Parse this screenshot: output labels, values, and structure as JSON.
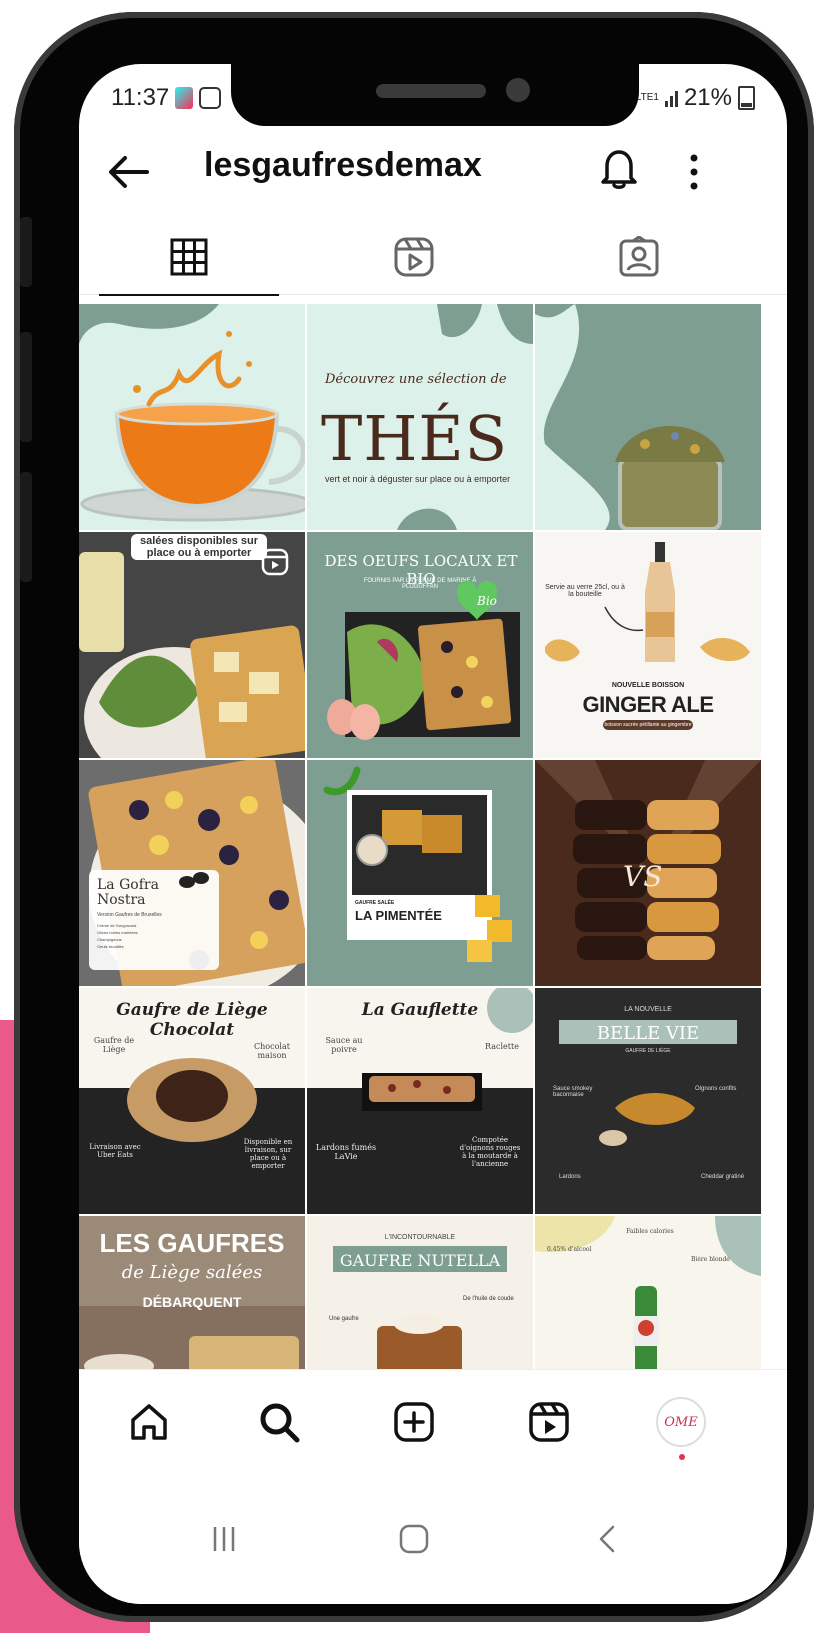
{
  "status_bar": {
    "time": "11:37",
    "network": "LTE1",
    "battery": "21%"
  },
  "header": {
    "username": "lesgaufresdemax"
  },
  "tabs": [
    {
      "name": "posts",
      "icon": "grid-icon",
      "active": true
    },
    {
      "name": "reels",
      "icon": "reels-icon",
      "active": false
    },
    {
      "name": "tagged",
      "icon": "tagged-icon",
      "active": false
    }
  ],
  "posts": {
    "p2_script": "Découvrez une sélection de",
    "p2_title": "THÉS",
    "p2_sub": "vert et noir à déguster sur place ou à emporter",
    "p4_banner": "salées disponibles sur place ou à emporter",
    "p5_title": "DES OEUFS LOCAUX ET BIO",
    "p5_sub": "FOURNIS PAR LA FERME DE MARINE À PLUGUFFAN",
    "p5_badge": "Bio",
    "p6_note": "Servie au verre 25cl, ou à la bouteille",
    "p6_small": "NOUVELLE BOISSON",
    "p6_title": "GINGER ALE",
    "p6_sub": "boisson sucrée pétillante au gingembre",
    "p7_title": "La Gofra Nostra",
    "p7_sub": "Version Gaufres de Bruxelles",
    "p7_items": [
      "Crème de Gorgonzola",
      "Olives noires marinées",
      "Champignons",
      "Oeufs brouillés"
    ],
    "p8_small": "GAUFRE SALÉE",
    "p8_title": "LA PIMENTÉE",
    "p9_vs": "VS",
    "p10_title": "Gaufre de Liège Chocolat",
    "p10_l1": "Gaufre de Liège",
    "p10_r1": "Chocolat maison",
    "p10_l2": "Livraison avec Uber Eats",
    "p10_r2": "Disponible en livraison, sur place ou à emporter",
    "p11_title": "La Gauflette",
    "p11_l1": "Sauce au poivre",
    "p11_r1": "Raclette",
    "p11_l2": "Lardons fumés LaVie",
    "p11_r2": "Compotée d'oignons rouges à la moutarde à l'ancienne",
    "p12_small": "LA NOUVELLE",
    "p12_title": "BELLE VIE",
    "p12_sub": "GAUFRE DE LIÈGE",
    "p12_l1": "Sauce smokey baconnaise",
    "p12_r1": "Oignons confits",
    "p12_l2": "Lardons",
    "p12_r2": "Cheddar gratiné",
    "p13_title": "LES GAUFRES",
    "p13_script": "de Liège salées",
    "p13_sub": "DÉBARQUENT",
    "p14_small": "L'INCONTOURNABLE",
    "p14_title": "GAUFRE NUTELLA",
    "p14_l1": "Une gaufre",
    "p14_r1": "De l'huile de coude",
    "p15_l1": "0.45% d'alcool",
    "p15_t1": "Faibles calories",
    "p15_r1": "Bière blonde"
  },
  "colors": {
    "sage": "#7e9e92",
    "mint": "#d9efe9",
    "brown": "#4a2a1c",
    "accent_pink": "#e95a8a"
  },
  "bottom_nav": [
    "home-icon",
    "search-icon",
    "create-icon",
    "reels-icon",
    "profile-avatar"
  ],
  "profile_avatar_text": "OME",
  "system_nav": [
    "recents-icon",
    "home-button-icon",
    "back-icon"
  ]
}
